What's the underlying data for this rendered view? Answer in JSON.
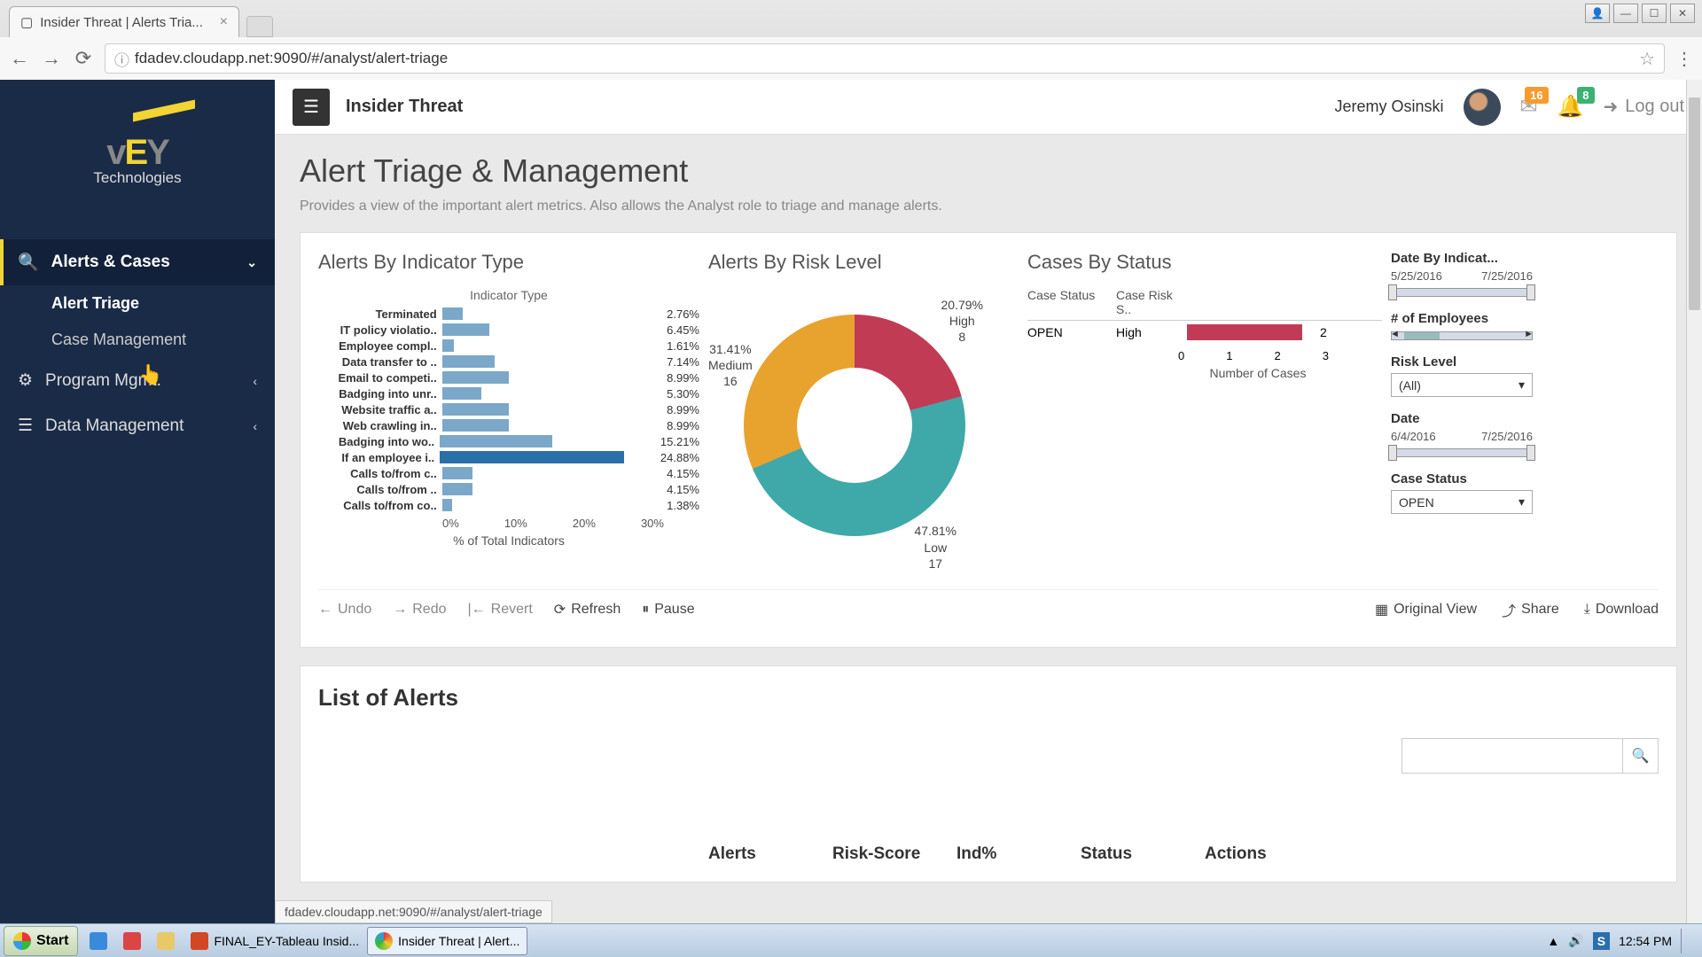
{
  "browser": {
    "tab_title": "Insider Threat | Alerts Tria...",
    "url": "fdadev.cloudapp.net:9090/#/analyst/alert-triage",
    "status_hover": "fdadev.cloudapp.net:9090/#/analyst/alert-triage"
  },
  "sidebar": {
    "logo_main": "vEY",
    "logo_sub": "Technologies",
    "sections": [
      {
        "label": "Alerts & Cases",
        "expanded": true
      },
      {
        "label": "Program Mgmt.",
        "expanded": false
      },
      {
        "label": "Data Management",
        "expanded": false
      }
    ],
    "sub_items": [
      {
        "label": "Alert Triage",
        "active": true
      },
      {
        "label": "Case Management",
        "active": false
      }
    ]
  },
  "topbar": {
    "app_title": "Insider Threat",
    "user": "Jeremy Osinski",
    "notif_count": "16",
    "bell_count": "8",
    "logout": "Log out"
  },
  "page": {
    "title": "Alert Triage & Management",
    "desc": "Provides a view of the important alert metrics.  Also allows the Analyst role to triage and manage alerts."
  },
  "chart_data": [
    {
      "type": "bar",
      "title": "Alerts By Indicator Type",
      "subtitle": "Indicator Type",
      "xlabel": "% of Total Indicators",
      "xlim": [
        0,
        30
      ],
      "xticks": [
        "0%",
        "10%",
        "20%",
        "30%"
      ],
      "categories": [
        "Terminated",
        "IT policy violatio..",
        "Employee compl..",
        "Data transfer to ..",
        "Email to competi..",
        "Badging into unr..",
        "Website traffic a..",
        "Web crawling in..",
        "Badging into wo..",
        "If an employee i..",
        "Calls to/from  c..",
        "Calls to/from ..",
        "Calls to/from co.."
      ],
      "values": [
        2.76,
        6.45,
        1.61,
        7.14,
        8.99,
        5.3,
        8.99,
        8.99,
        15.21,
        24.88,
        4.15,
        4.15,
        1.38
      ],
      "highlight_index": 9
    },
    {
      "type": "pie",
      "title": "Alerts By Risk Level",
      "series": [
        {
          "name": "High",
          "value": 8,
          "pct": 20.79,
          "color": "#c23b55"
        },
        {
          "name": "Low",
          "value": 17,
          "pct": 47.81,
          "color": "#3fa9a9"
        },
        {
          "name": "Medium",
          "value": 16,
          "pct": 31.41,
          "color": "#e8a22e"
        }
      ]
    },
    {
      "type": "bar",
      "title": "Cases By Status",
      "columns": [
        "Case Status",
        "Case Risk S.."
      ],
      "rows": [
        {
          "status": "OPEN",
          "risk": "High",
          "value": 2
        }
      ],
      "xlabel": "Number of Cases",
      "xlim": [
        0,
        3
      ],
      "xticks": [
        "0",
        "1",
        "2",
        "3"
      ]
    }
  ],
  "filters": {
    "date_indicator": {
      "title": "Date By Indicat...",
      "start": "5/25/2016",
      "end": "7/25/2016"
    },
    "employees": {
      "title": "# of Employees"
    },
    "risk_level": {
      "title": "Risk Level",
      "value": "(All)"
    },
    "date": {
      "title": "Date",
      "start": "6/4/2016",
      "end": "7/25/2016"
    },
    "case_status": {
      "title": "Case Status",
      "value": "OPEN"
    }
  },
  "toolbar": {
    "undo": "Undo",
    "redo": "Redo",
    "revert": "Revert",
    "refresh": "Refresh",
    "pause": "Pause",
    "original_view": "Original View",
    "share": "Share",
    "download": "Download"
  },
  "list": {
    "title": "List of Alerts",
    "columns": [
      "Alerts",
      "Risk-Score",
      "Ind%",
      "Status",
      "Actions"
    ]
  },
  "taskbar": {
    "start": "Start",
    "items": [
      {
        "label": "FINAL_EY-Tableau Insid...",
        "type": "ppt"
      },
      {
        "label": "Insider Threat | Alert...",
        "type": "chrome",
        "active": true
      }
    ],
    "clock": "12:54 PM"
  }
}
